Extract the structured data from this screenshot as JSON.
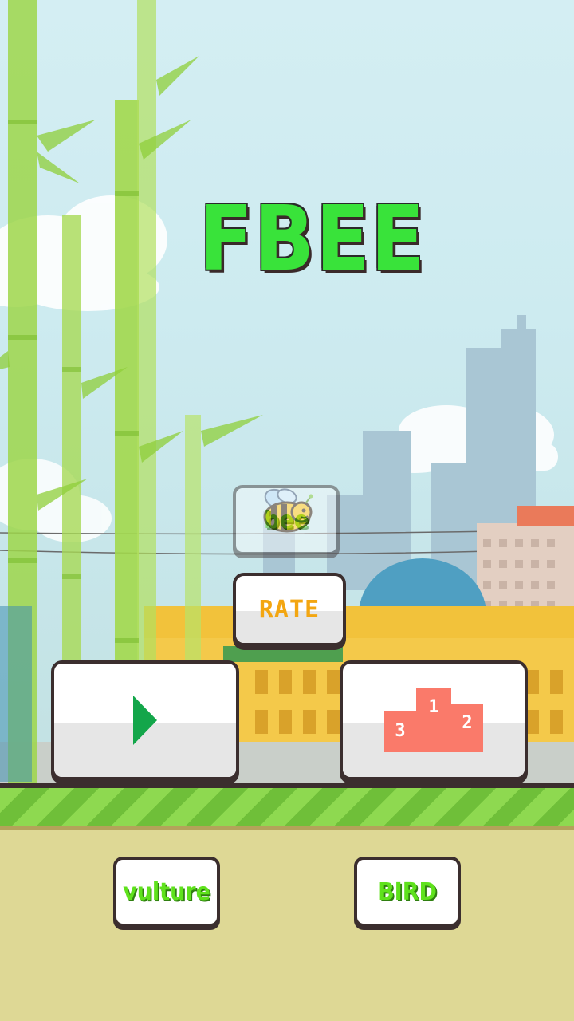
{
  "game": {
    "title": "FBEE"
  },
  "menu": {
    "rate_label": "RATE",
    "play_icon": "play-triangle-icon",
    "leaderboard_icon": "podium-icon",
    "podium_labels": [
      "1",
      "2",
      "3"
    ]
  },
  "characters": [
    {
      "label": "vulture",
      "state": "available"
    },
    {
      "label": "bee",
      "state": "selected"
    },
    {
      "label": "BIRD",
      "state": "available"
    }
  ],
  "colors": {
    "title_green": "#39e33a",
    "rate_orange": "#f3a611",
    "play_green": "#13a64a",
    "podium_salmon": "#fa7a6a",
    "ground_light": "#8ed950",
    "ground_dark": "#6fbf39",
    "sand": "#ded895",
    "char_label_green": "#5fe21c"
  }
}
